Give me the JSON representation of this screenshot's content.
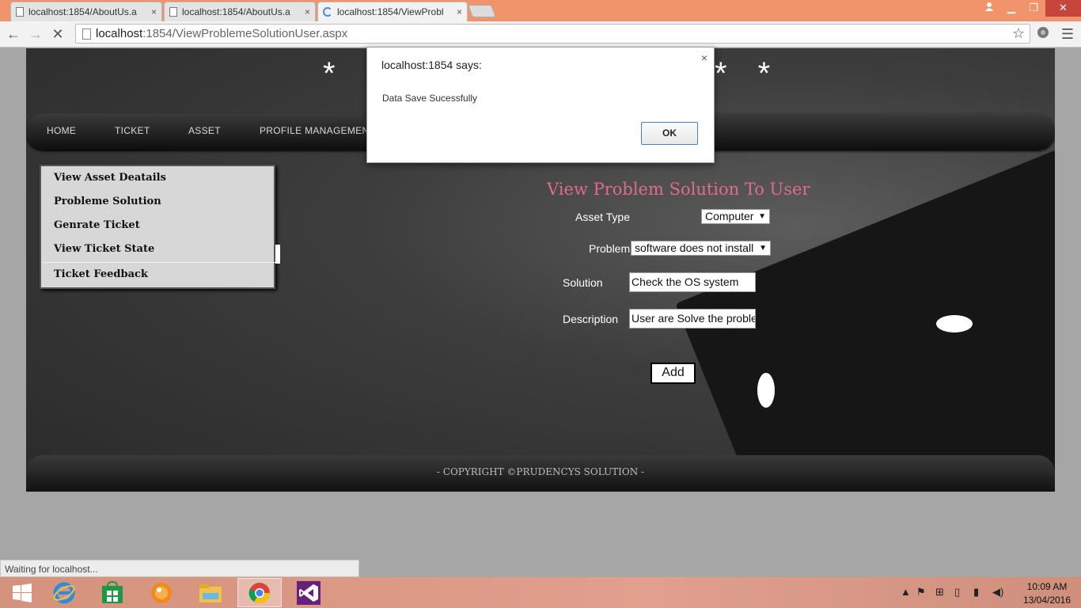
{
  "browser": {
    "tabs": [
      {
        "title": "localhost:1854/AboutUs.a",
        "close": "×"
      },
      {
        "title": "localhost:1854/AboutUs.a",
        "close": "×"
      },
      {
        "title": "localhost:1854/ViewProbl",
        "close": "×"
      }
    ],
    "url_host": "localhost",
    "url_rest": ":1854/ViewProblemeSolutionUser.aspx",
    "window_controls": {
      "minimize": "▁",
      "restore": "❐",
      "close": "✕"
    }
  },
  "page": {
    "banner_left": "* *",
    "banner_right": "* *",
    "nav": [
      "HOME",
      "TICKET",
      "ASSET",
      "PROFILE MANAGEMEN"
    ],
    "sidebar": [
      "View Asset Deatails",
      "Probleme Solution",
      "Genrate Ticket",
      "View Ticket State",
      "Ticket Feedback"
    ],
    "form": {
      "title": "View Problem Solution To User",
      "asset_type_label": "Asset Type",
      "asset_type_value": "Computer",
      "problem_label": "Problem",
      "problem_value": "software does not install",
      "solution_label": "Solution",
      "solution_value": "Check the OS system",
      "description_label": "Description",
      "description_value": "User are Solve the proble",
      "add_label": "Add"
    },
    "footer": "- COPYRIGHT ©PRUDENCYS SOLUTION -"
  },
  "dialog": {
    "title": "localhost:1854 says:",
    "message": "Data Save Sucessfully",
    "ok_label": "OK",
    "close": "×"
  },
  "status": "Waiting for localhost...",
  "taskbar": {
    "time": "10:09 AM",
    "date": "13/04/2016",
    "apps": [
      "start-icon",
      "internet-explorer-icon",
      "store-icon",
      "media-player-icon",
      "file-explorer-icon",
      "chrome-icon",
      "visual-studio-icon"
    ]
  }
}
